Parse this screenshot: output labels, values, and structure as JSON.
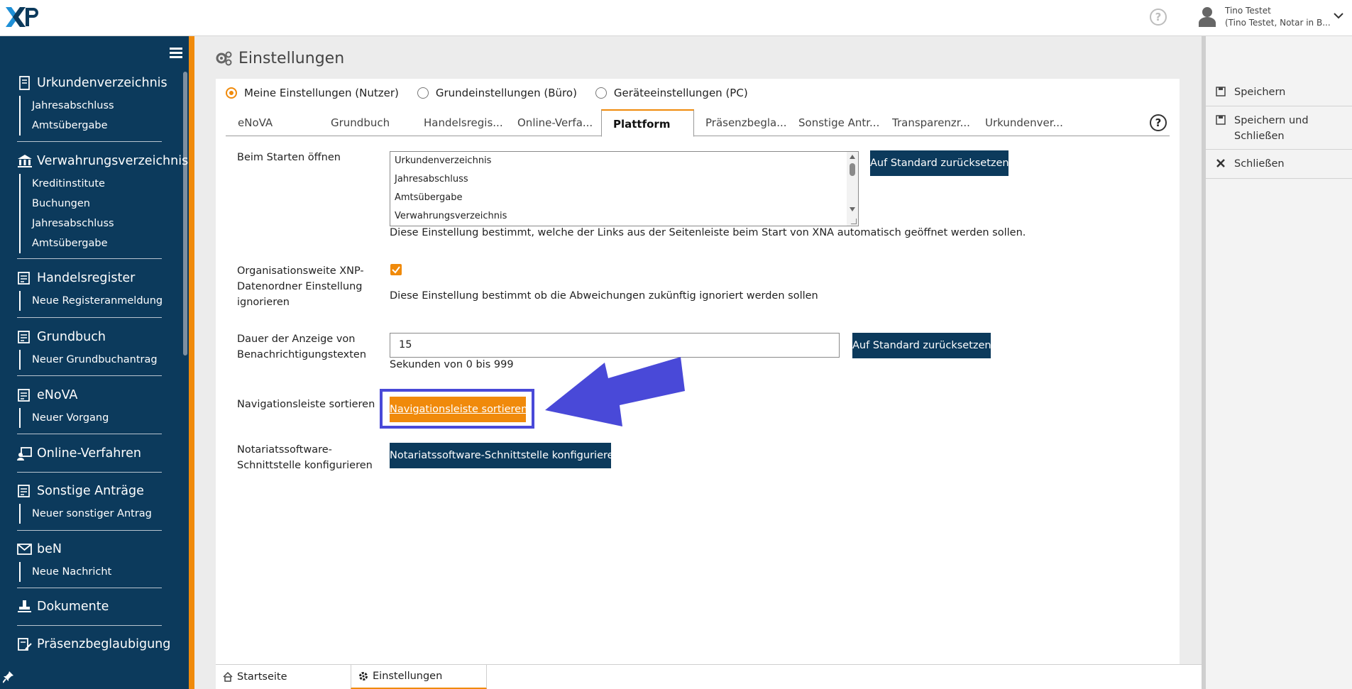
{
  "header": {
    "logo_text": "XNP",
    "user_name": "Tino Testet",
    "user_role": "(Tino Testet, Notar in B..."
  },
  "sidebar": {
    "sections": [
      {
        "label": "Urkundenverzeichnis",
        "icon": "book-icon",
        "items": [
          "Jahresabschluss",
          "Amtsübergabe"
        ]
      },
      {
        "label": "Verwahrungsverzeichnis",
        "icon": "bank-icon",
        "items": [
          "Kreditinstitute",
          "Buchungen",
          "Jahresabschluss",
          "Amtsübergabe"
        ]
      },
      {
        "label": "Handelsregister",
        "icon": "register-icon",
        "items": [
          "Neue Registeranmeldung"
        ]
      },
      {
        "label": "Grundbuch",
        "icon": "register-icon",
        "items": [
          "Neuer Grundbuchantrag"
        ]
      },
      {
        "label": "eNoVA",
        "icon": "register-icon",
        "items": [
          "Neuer Vorgang"
        ]
      },
      {
        "label": "Online-Verfahren",
        "icon": "online-icon",
        "items": []
      },
      {
        "label": "Sonstige Anträge",
        "icon": "register-icon",
        "items": [
          "Neuer sonstiger Antrag"
        ]
      },
      {
        "label": "beN",
        "icon": "mail-icon",
        "items": [
          "Neue Nachricht"
        ]
      },
      {
        "label": "Dokumente",
        "icon": "stamp-icon",
        "items": []
      },
      {
        "label": "Präsenzbeglaubigung",
        "icon": "certify-icon",
        "items": []
      }
    ]
  },
  "page": {
    "title": "Einstellungen",
    "radios": [
      {
        "label": "Meine Einstellungen (Nutzer)",
        "selected": true
      },
      {
        "label": "Grundeinstellungen (Büro)",
        "selected": false
      },
      {
        "label": "Geräteeinstellungen (PC)",
        "selected": false
      }
    ],
    "tabs": [
      "eNoVA",
      "Grundbuch",
      "Handelsregis...",
      "Online-Verfa...",
      "Plattform",
      "Präsenzbegla...",
      "Sonstige Antr...",
      "Transparenzr...",
      "Urkundenver..."
    ],
    "active_tab": "Plattform"
  },
  "settings": {
    "startup": {
      "label": "Beim Starten öffnen",
      "options": [
        "Urkundenverzeichnis",
        "Jahresabschluss",
        "Amtsübergabe",
        "Verwahrungsverzeichnis"
      ],
      "reset_label": "Auf Standard zurücksetzen",
      "hint": "Diese Einstellung bestimmt, welche der Links aus der Seitenleiste beim Start von XNA automatisch geöffnet werden sollen."
    },
    "ignore_folder": {
      "label_1": "Organisationsweite XNP-",
      "label_2": "Datenordner Einstellung",
      "label_3": "ignorieren",
      "checked": true,
      "hint": "Diese Einstellung bestimmt ob die Abweichungen zukünftig ignoriert werden sollen"
    },
    "notification_duration": {
      "label_1": "Dauer der Anzeige von",
      "label_2": "Benachrichtigungstexten",
      "value": "15",
      "reset_label": "Auf Standard zurücksetzen",
      "hint": "Sekunden von 0 bis 999"
    },
    "nav_sort": {
      "label": "Navigationsleiste sortieren",
      "button": "Navigationsleiste sortieren"
    },
    "interface": {
      "label_1": "Notariatssoftware-",
      "label_2": "Schnittstelle konfigurieren",
      "button": "Notariatssoftware-Schnittstelle konfigurieren"
    }
  },
  "actions": {
    "save": "Speichern",
    "save_close_1": "Speichern und",
    "save_close_2": "Schließen",
    "close": "Schließen"
  },
  "bottom_tabs": {
    "home": "Startseite",
    "settings": "Einstellungen"
  },
  "colors": {
    "navy": "#0c3a5c",
    "orange": "#f08a0b",
    "highlight": "#4949d8"
  }
}
